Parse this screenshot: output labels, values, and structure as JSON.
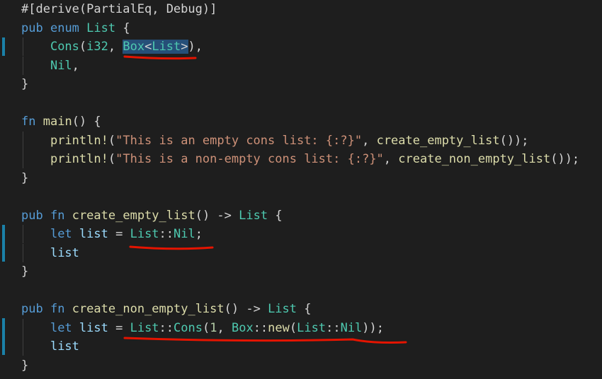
{
  "editor": {
    "lines": [
      [
        {
          "t": "#[derive(PartialEq, Debug)]",
          "c": ""
        }
      ],
      [
        {
          "t": "pub",
          "c": "kw"
        },
        {
          "t": " ",
          "c": ""
        },
        {
          "t": "enum",
          "c": "kw"
        },
        {
          "t": " ",
          "c": ""
        },
        {
          "t": "List",
          "c": "ty"
        },
        {
          "t": " {",
          "c": ""
        }
      ],
      [
        {
          "t": "    ",
          "c": ""
        },
        {
          "t": "Cons",
          "c": "ty"
        },
        {
          "t": "(",
          "c": ""
        },
        {
          "t": "i32",
          "c": "ty"
        },
        {
          "t": ", ",
          "c": ""
        },
        {
          "t": "Box",
          "c": "ty sel"
        },
        {
          "t": "<",
          "c": "sel"
        },
        {
          "t": "List",
          "c": "ty sel"
        },
        {
          "t": ">",
          "c": "sel"
        },
        {
          "t": "),",
          "c": ""
        }
      ],
      [
        {
          "t": "    ",
          "c": ""
        },
        {
          "t": "Nil",
          "c": "ty"
        },
        {
          "t": ",",
          "c": ""
        }
      ],
      [
        {
          "t": "}",
          "c": ""
        }
      ],
      [],
      [
        {
          "t": "fn",
          "c": "kw"
        },
        {
          "t": " ",
          "c": ""
        },
        {
          "t": "main",
          "c": "fn"
        },
        {
          "t": "() {",
          "c": ""
        }
      ],
      [
        {
          "t": "    ",
          "c": ""
        },
        {
          "t": "println!",
          "c": "fn"
        },
        {
          "t": "(",
          "c": ""
        },
        {
          "t": "\"This is an empty cons list: {:?}\"",
          "c": "str"
        },
        {
          "t": ", ",
          "c": ""
        },
        {
          "t": "create_empty_list",
          "c": "fn"
        },
        {
          "t": "());",
          "c": ""
        }
      ],
      [
        {
          "t": "    ",
          "c": ""
        },
        {
          "t": "println!",
          "c": "fn"
        },
        {
          "t": "(",
          "c": ""
        },
        {
          "t": "\"This is a non-empty cons list: {:?}\"",
          "c": "str"
        },
        {
          "t": ", ",
          "c": ""
        },
        {
          "t": "create_non_empty_list",
          "c": "fn"
        },
        {
          "t": "());",
          "c": ""
        }
      ],
      [
        {
          "t": "}",
          "c": ""
        }
      ],
      [],
      [
        {
          "t": "pub",
          "c": "kw"
        },
        {
          "t": " ",
          "c": ""
        },
        {
          "t": "fn",
          "c": "kw"
        },
        {
          "t": " ",
          "c": ""
        },
        {
          "t": "create_empty_list",
          "c": "fn"
        },
        {
          "t": "() -> ",
          "c": ""
        },
        {
          "t": "List",
          "c": "ty"
        },
        {
          "t": " {",
          "c": ""
        }
      ],
      [
        {
          "t": "    ",
          "c": ""
        },
        {
          "t": "let",
          "c": "kw"
        },
        {
          "t": " ",
          "c": ""
        },
        {
          "t": "list",
          "c": "var"
        },
        {
          "t": " = ",
          "c": ""
        },
        {
          "t": "List",
          "c": "ty"
        },
        {
          "t": "::",
          "c": ""
        },
        {
          "t": "Nil",
          "c": "ty"
        },
        {
          "t": ";",
          "c": ""
        }
      ],
      [
        {
          "t": "    ",
          "c": ""
        },
        {
          "t": "list",
          "c": "var"
        }
      ],
      [
        {
          "t": "}",
          "c": ""
        }
      ],
      [],
      [
        {
          "t": "pub",
          "c": "kw"
        },
        {
          "t": " ",
          "c": ""
        },
        {
          "t": "fn",
          "c": "kw"
        },
        {
          "t": " ",
          "c": ""
        },
        {
          "t": "create_non_empty_list",
          "c": "fn"
        },
        {
          "t": "() -> ",
          "c": ""
        },
        {
          "t": "List",
          "c": "ty"
        },
        {
          "t": " {",
          "c": ""
        }
      ],
      [
        {
          "t": "    ",
          "c": ""
        },
        {
          "t": "let",
          "c": "kw"
        },
        {
          "t": " ",
          "c": ""
        },
        {
          "t": "list",
          "c": "var"
        },
        {
          "t": " = ",
          "c": ""
        },
        {
          "t": "List",
          "c": "ty"
        },
        {
          "t": "::",
          "c": ""
        },
        {
          "t": "Cons",
          "c": "ty"
        },
        {
          "t": "(",
          "c": ""
        },
        {
          "t": "1",
          "c": "num"
        },
        {
          "t": ", ",
          "c": ""
        },
        {
          "t": "Box",
          "c": "ty"
        },
        {
          "t": "::",
          "c": ""
        },
        {
          "t": "new",
          "c": "fn"
        },
        {
          "t": "(",
          "c": ""
        },
        {
          "t": "List",
          "c": "ty"
        },
        {
          "t": "::",
          "c": ""
        },
        {
          "t": "Nil",
          "c": "ty"
        },
        {
          "t": "));",
          "c": ""
        }
      ],
      [
        {
          "t": "    ",
          "c": ""
        },
        {
          "t": "list",
          "c": "var"
        }
      ],
      [
        {
          "t": "}",
          "c": ""
        }
      ]
    ]
  },
  "colors": {
    "background": "#1e1e1e",
    "default_text": "#d4d4d4",
    "keyword": "#569cd6",
    "type": "#4ec9b0",
    "function": "#dcdcaa",
    "string": "#ce9178",
    "number": "#b5cea8",
    "variable": "#9cdcfe",
    "selection": "#264f78",
    "gutter_marker": "#1b81a8",
    "annotation_underline": "#e51400"
  }
}
